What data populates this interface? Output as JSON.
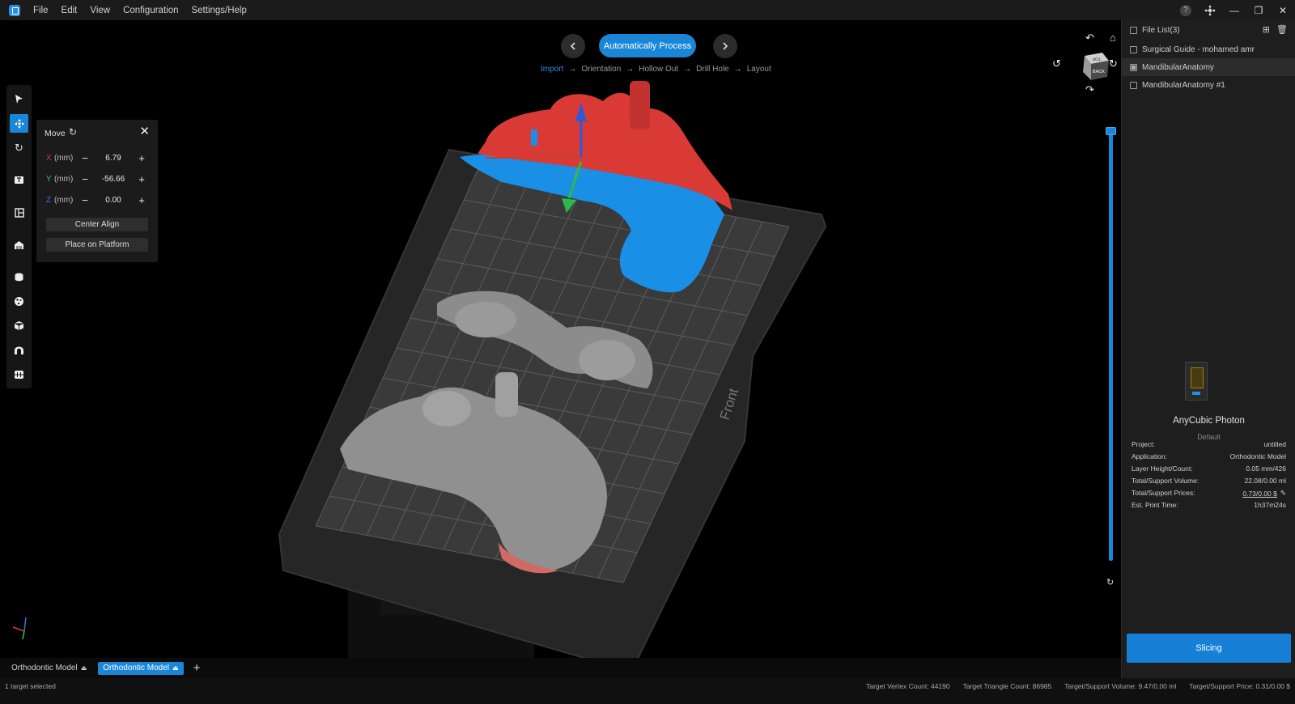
{
  "menu": {
    "items": [
      "File",
      "Edit",
      "View",
      "Configuration",
      "Settings/Help"
    ]
  },
  "window_controls": {
    "help": "?",
    "minimize": "—",
    "maximize": "❐",
    "close": "✕"
  },
  "process": {
    "button_label": "Automatically Process",
    "steps": [
      "Import",
      "Orientation",
      "Hollow Out",
      "Drill Hole",
      "Layout"
    ],
    "active_step": "Import",
    "prev_icon": "chevron-left-icon",
    "next_icon": "chevron-right-icon"
  },
  "left_toolbar": {
    "tools": [
      "select-icon",
      "move-icon",
      "rotate-icon",
      "scale-icon",
      "layout-icon",
      "support-icon",
      "hollow-icon",
      "drill-icon",
      "cube-icon",
      "arch-icon",
      "teeth-icon"
    ],
    "active_tool": "move-icon"
  },
  "move_panel": {
    "title": "Move",
    "x_label": "X",
    "y_label": "Y",
    "z_label": "Z",
    "unit": "(mm)",
    "x_value": "6.79",
    "y_value": "-56.66",
    "z_value": "0.00",
    "center_align": "Center Align",
    "place_on_platform": "Place on Platform",
    "colors": {
      "x": "#d23b3b",
      "y": "#39c24a",
      "z": "#3d6de0"
    }
  },
  "viewport": {
    "platform_label": "Front",
    "nav_cube_labels": {
      "top": "TOP",
      "back": "BACK"
    }
  },
  "file_list": {
    "title": "File List(3)",
    "files": [
      {
        "name": "Surgical Guide - mohamed amr",
        "checked": false,
        "selected": false
      },
      {
        "name": "MandibularAnatomy",
        "checked": true,
        "selected": true
      },
      {
        "name": "MandibularAnatomy #1",
        "checked": false,
        "selected": false
      }
    ]
  },
  "printer": {
    "name": "AnyCubic Photon",
    "profile": "Default",
    "info": [
      {
        "label": "Project:",
        "value": "untitled"
      },
      {
        "label": "Application:",
        "value": "Orthodontic Model"
      },
      {
        "label": "Layer Height/Count:",
        "value": "0.05 mm/426"
      },
      {
        "label": "Total/Support Volume:",
        "value": "22.08/0.00 ml"
      },
      {
        "label": "Total/Support Prices:",
        "value": "0.73/0.00 $"
      },
      {
        "label": "Est. Print Time:",
        "value": "1h37m24s"
      }
    ]
  },
  "slicing_label": "Slicing",
  "tabs": [
    {
      "label": "Orthodontic Model",
      "active": false
    },
    {
      "label": "Orthodontic Model",
      "active": true
    }
  ],
  "status": {
    "selection": "1 target selected",
    "vertex_count": "Target Vertex Count: 44190",
    "triangle_count": "Target Triangle Count: 86985",
    "support_volume": "Target/Support Volume: 9.47/0.00 ml",
    "support_price": "Target/Support Price: 0.31/0.00 $"
  },
  "colors": {
    "accent": "#1a86d8",
    "selected_red": "#d93a36",
    "selected_blue": "#1a8fe6",
    "model_gray": "#8c8c8c"
  }
}
